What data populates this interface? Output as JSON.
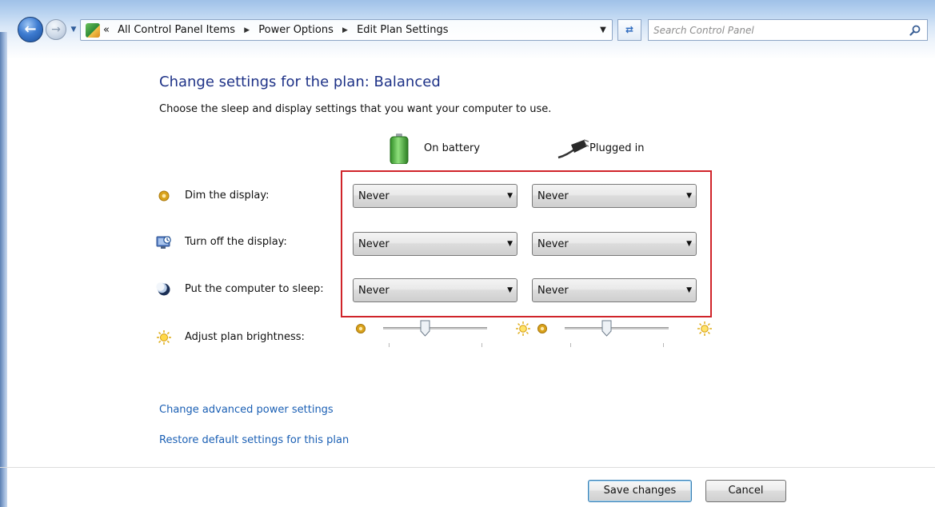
{
  "address_bar": {
    "overflow_chevron": "«",
    "breadcrumbs": [
      "All Control Panel Items",
      "Power Options",
      "Edit Plan Settings"
    ],
    "icon": "control-panel-icon"
  },
  "search": {
    "placeholder": "Search Control Panel"
  },
  "page": {
    "title": "Change settings for the plan: Balanced",
    "subtitle": "Choose the sleep and display settings that you want your computer to use."
  },
  "columns": {
    "battery": "On battery",
    "plugged": "Plugged in"
  },
  "settings": [
    {
      "label": "Dim the display:",
      "icon": "dim-display-icon",
      "battery": "Never",
      "plugged": "Never"
    },
    {
      "label": "Turn off the display:",
      "icon": "display-off-icon",
      "battery": "Never",
      "plugged": "Never"
    },
    {
      "label": "Put the computer to sleep:",
      "icon": "sleep-icon",
      "battery": "Never",
      "plugged": "Never"
    }
  ],
  "brightness": {
    "label": "Adjust plan brightness:",
    "battery_level": 0.4,
    "plugged_level": 0.4
  },
  "links": {
    "advanced": "Change advanced power settings",
    "restore": "Restore default settings for this plan"
  },
  "buttons": {
    "save": "Save changes",
    "cancel": "Cancel"
  },
  "colors": {
    "title": "#1e3287",
    "link": "#1a5fb4",
    "highlight": "#d0242a"
  }
}
